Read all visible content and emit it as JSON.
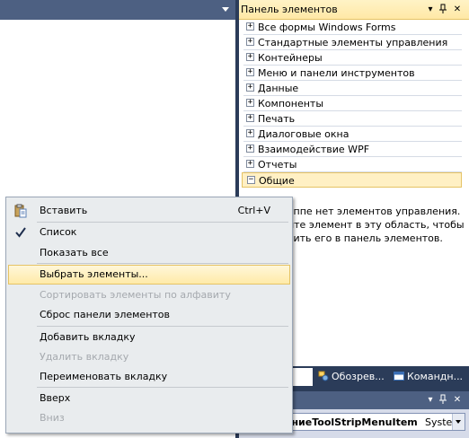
{
  "toolbox": {
    "title": "Панель элементов",
    "categories": [
      {
        "label": "Все формы Windows Forms",
        "sign": "+"
      },
      {
        "label": "Стандартные элементы управления",
        "sign": "+"
      },
      {
        "label": "Контейнеры",
        "sign": "+"
      },
      {
        "label": "Меню и панели инструментов",
        "sign": "+"
      },
      {
        "label": "Данные",
        "sign": "+"
      },
      {
        "label": "Компоненты",
        "sign": "+"
      },
      {
        "label": "Печать",
        "sign": "+"
      },
      {
        "label": "Диалоговые окна",
        "sign": "+"
      },
      {
        "label": "Взаимодействие WPF",
        "sign": "+"
      },
      {
        "label": "Отчеты",
        "sign": "+"
      },
      {
        "label": "Общие",
        "sign": "−"
      }
    ],
    "empty_message": "уппе нет элементов управления.\nите элемент в эту область, чтобы\nвить его в панель элементов."
  },
  "bottom_tabs": [
    {
      "label": "Обозрев..."
    },
    {
      "label": "Командн..."
    }
  ],
  "properties": {
    "object_name": "ениеToolStripMenuItem",
    "object_type": "Systen"
  },
  "context_menu": {
    "items": [
      {
        "label": "Вставить",
        "shortcut": "Ctrl+V"
      },
      {
        "label": "Список"
      },
      {
        "label": "Показать все"
      },
      {
        "label": "Выбрать элементы..."
      },
      {
        "label": "Сортировать элементы по алфавиту"
      },
      {
        "label": "Сброс панели элементов"
      },
      {
        "label": "Добавить вкладку"
      },
      {
        "label": "Удалить вкладку"
      },
      {
        "label": "Переименовать вкладку"
      },
      {
        "label": "Вверх"
      },
      {
        "label": "Вниз"
      }
    ]
  },
  "colors": {
    "ide_background": "#2b3c59",
    "highlight": "#ffeaa8",
    "highlight_border": "#e5c365",
    "menu_background": "#e9ecee",
    "disabled_text": "#a5a9ae"
  }
}
